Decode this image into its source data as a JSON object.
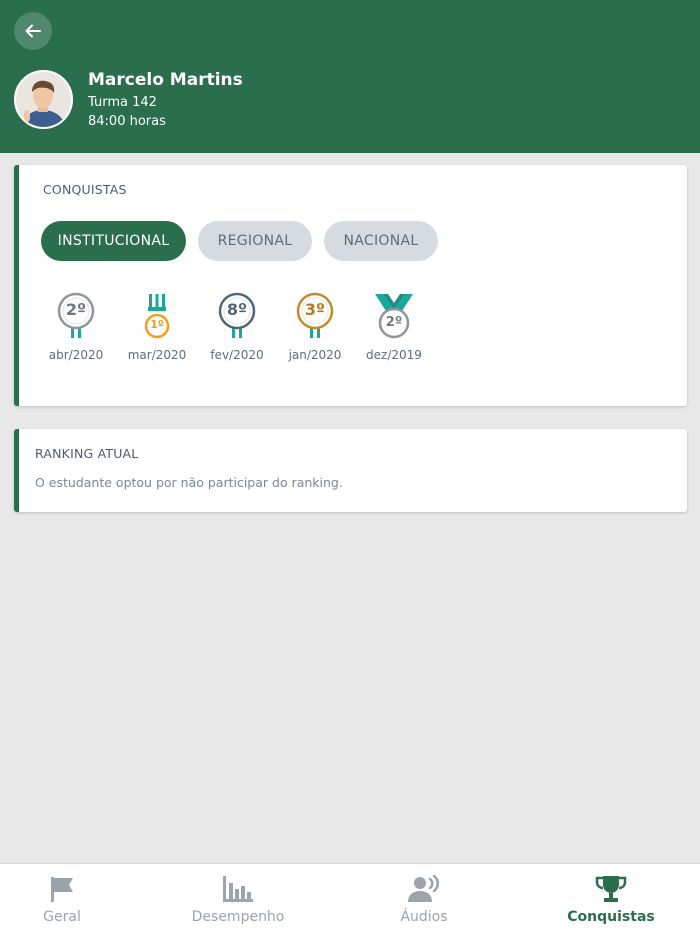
{
  "header": {
    "name": "Marcelo Martins",
    "class": "Turma 142",
    "hours": "84:00 horas"
  },
  "achievements": {
    "title": "CONQUISTAS",
    "tabs": [
      {
        "label": "INSTITUCIONAL",
        "active": true
      },
      {
        "label": "REGIONAL",
        "active": false
      },
      {
        "label": "NACIONAL",
        "active": false
      }
    ],
    "medals": [
      {
        "rank": "2º",
        "date": "abr/2020",
        "color": "#8e959b",
        "ribbon": "#1aa89a"
      },
      {
        "rank": "1º",
        "date": "mar/2020",
        "color": "#f0a020",
        "ribbon": "#1aa89a"
      },
      {
        "rank": "8º",
        "date": "fev/2020",
        "color": "#4e6878",
        "ribbon": "#1aa89a"
      },
      {
        "rank": "3º",
        "date": "jan/2020",
        "color": "#c48a2c",
        "ribbon": "#1aa89a"
      },
      {
        "rank": "2º",
        "date": "dez/2019",
        "color": "#8e959b",
        "ribbon": "#1aa89a"
      }
    ]
  },
  "ranking": {
    "title": "RANKING ATUAL",
    "message": "O estudante optou por não participar do ranking."
  },
  "tabbar": {
    "items": [
      {
        "label": "Geral",
        "icon": "flag-icon",
        "active": false
      },
      {
        "label": "Desempenho",
        "icon": "bar-chart-icon",
        "active": false
      },
      {
        "label": "Áudios",
        "icon": "speaker-icon",
        "active": false
      },
      {
        "label": "Conquistas",
        "icon": "trophy-icon",
        "active": true
      }
    ]
  },
  "colors": {
    "primary": "#2a6e4d",
    "inactive_pill": "#d5dbe0",
    "background": "#e8e8e8"
  }
}
